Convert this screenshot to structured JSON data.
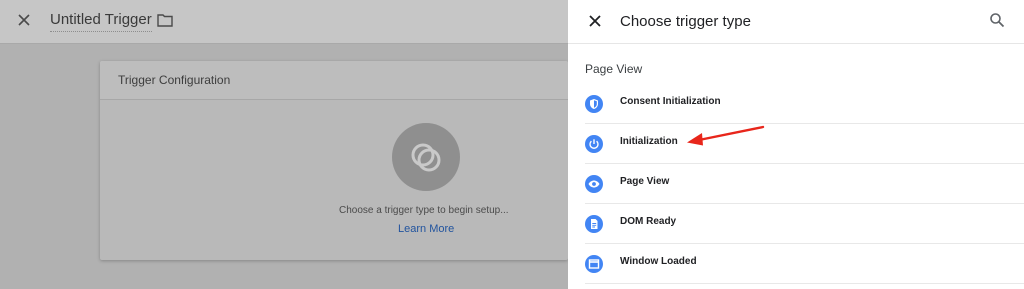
{
  "background": {
    "title": "Untitled Trigger",
    "card": {
      "title": "Trigger Configuration",
      "hint": "Choose a trigger type to begin setup...",
      "link": "Learn More"
    }
  },
  "panel": {
    "title": "Choose trigger type",
    "section": "Page View",
    "items": [
      {
        "label": "Consent Initialization",
        "icon": "shield-icon"
      },
      {
        "label": "Initialization",
        "icon": "power-icon"
      },
      {
        "label": "Page View",
        "icon": "eye-icon"
      },
      {
        "label": "DOM Ready",
        "icon": "document-icon"
      },
      {
        "label": "Window Loaded",
        "icon": "window-icon"
      }
    ]
  },
  "colors": {
    "accent": "#4285f4",
    "annotation_arrow": "#e8261b",
    "link": "#1a73e8"
  }
}
